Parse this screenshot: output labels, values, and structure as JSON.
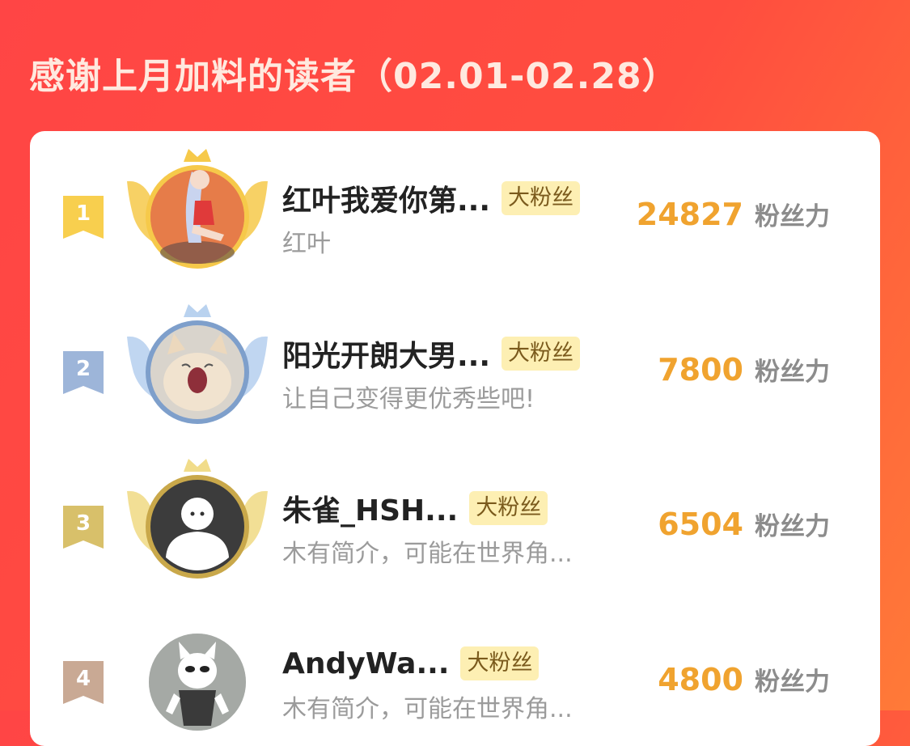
{
  "header": {
    "title": "感谢上月加料的读者（02.01-02.28）"
  },
  "colors": {
    "accent": "#f0a32f",
    "gold": "#f5c542",
    "silver": "#7e9fcb",
    "bronze": "#c9a84a",
    "badge_bg": "#fdefb3"
  },
  "readers": [
    {
      "rank": "1",
      "name": "红叶我爱你第...",
      "badge": "大粉丝",
      "bio": "红叶",
      "score": "24827",
      "unit": "粉丝力",
      "tier": "gold",
      "avatar_icon": "anime-girl-avatar-icon"
    },
    {
      "rank": "2",
      "name": "阳光开朗大男...",
      "badge": "大粉丝",
      "bio": "让自己变得更优秀些吧!",
      "score": "7800",
      "unit": "粉丝力",
      "tier": "silver",
      "avatar_icon": "yawning-cat-avatar-icon"
    },
    {
      "rank": "3",
      "name": "朱雀_HSH...",
      "badge": "大粉丝",
      "bio": "木有简介，可能在世界角...",
      "score": "6504",
      "unit": "粉丝力",
      "tier": "bronze",
      "avatar_icon": "default-user-avatar-icon"
    },
    {
      "rank": "4",
      "name": "AndyWa...",
      "badge": "大粉丝",
      "bio": "木有简介，可能在世界角...",
      "score": "4800",
      "unit": "粉丝力",
      "tier": "plain",
      "avatar_icon": "figure-photo-avatar-icon"
    }
  ]
}
